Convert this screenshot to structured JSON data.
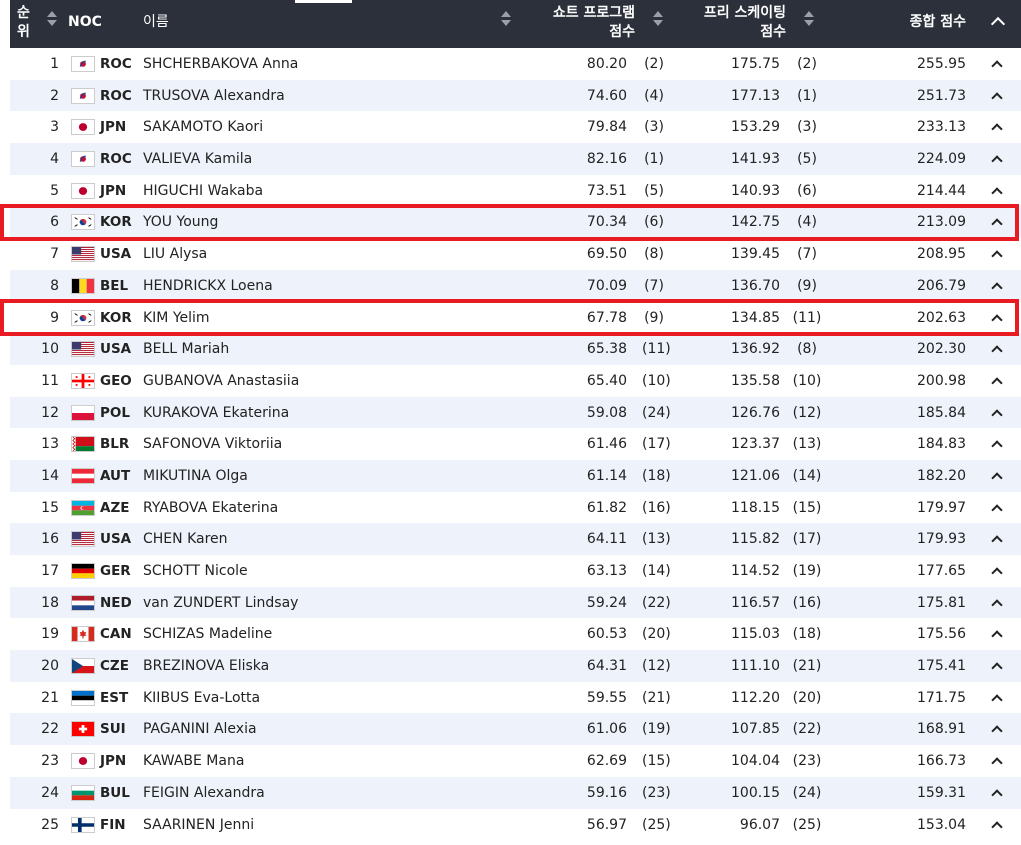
{
  "header": {
    "rank_line1": "순",
    "rank_line2": "위",
    "noc": "NOC",
    "name": "이름",
    "sp_line1": "쇼트 프로그램",
    "sp_line2": "점수",
    "fs_line1": "프리 스케이팅",
    "fs_line2": "점수",
    "total": "종합 점수"
  },
  "highlighted_ranks": [
    6,
    9
  ],
  "rows": [
    {
      "rank": "1",
      "flag": "ROC",
      "noc": "ROC",
      "name": "SHCHERBAKOVA Anna",
      "sp": "80.20",
      "sp_rank": "(2)",
      "fs": "175.75",
      "fs_rank": "(2)",
      "total": "255.95"
    },
    {
      "rank": "2",
      "flag": "ROC",
      "noc": "ROC",
      "name": "TRUSOVA Alexandra",
      "sp": "74.60",
      "sp_rank": "(4)",
      "fs": "177.13",
      "fs_rank": "(1)",
      "total": "251.73"
    },
    {
      "rank": "3",
      "flag": "JPN",
      "noc": "JPN",
      "name": "SAKAMOTO Kaori",
      "sp": "79.84",
      "sp_rank": "(3)",
      "fs": "153.29",
      "fs_rank": "(3)",
      "total": "233.13"
    },
    {
      "rank": "4",
      "flag": "ROC",
      "noc": "ROC",
      "name": "VALIEVA Kamila",
      "sp": "82.16",
      "sp_rank": "(1)",
      "fs": "141.93",
      "fs_rank": "(5)",
      "total": "224.09"
    },
    {
      "rank": "5",
      "flag": "JPN",
      "noc": "JPN",
      "name": "HIGUCHI Wakaba",
      "sp": "73.51",
      "sp_rank": "(5)",
      "fs": "140.93",
      "fs_rank": "(6)",
      "total": "214.44"
    },
    {
      "rank": "6",
      "flag": "KOR",
      "noc": "KOR",
      "name": "YOU Young",
      "sp": "70.34",
      "sp_rank": "(6)",
      "fs": "142.75",
      "fs_rank": "(4)",
      "total": "213.09"
    },
    {
      "rank": "7",
      "flag": "USA",
      "noc": "USA",
      "name": "LIU Alysa",
      "sp": "69.50",
      "sp_rank": "(8)",
      "fs": "139.45",
      "fs_rank": "(7)",
      "total": "208.95"
    },
    {
      "rank": "8",
      "flag": "BEL",
      "noc": "BEL",
      "name": "HENDRICKX Loena",
      "sp": "70.09",
      "sp_rank": "(7)",
      "fs": "136.70",
      "fs_rank": "(9)",
      "total": "206.79"
    },
    {
      "rank": "9",
      "flag": "KOR",
      "noc": "KOR",
      "name": "KIM Yelim",
      "sp": "67.78",
      "sp_rank": "(9)",
      "fs": "134.85",
      "fs_rank": "(11)",
      "total": "202.63"
    },
    {
      "rank": "10",
      "flag": "USA",
      "noc": "USA",
      "name": "BELL Mariah",
      "sp": "65.38",
      "sp_rank": "(11)",
      "fs": "136.92",
      "fs_rank": "(8)",
      "total": "202.30"
    },
    {
      "rank": "11",
      "flag": "GEO",
      "noc": "GEO",
      "name": "GUBANOVA Anastasiia",
      "sp": "65.40",
      "sp_rank": "(10)",
      "fs": "135.58",
      "fs_rank": "(10)",
      "total": "200.98"
    },
    {
      "rank": "12",
      "flag": "POL",
      "noc": "POL",
      "name": "KURAKOVA Ekaterina",
      "sp": "59.08",
      "sp_rank": "(24)",
      "fs": "126.76",
      "fs_rank": "(12)",
      "total": "185.84"
    },
    {
      "rank": "13",
      "flag": "BLR",
      "noc": "BLR",
      "name": "SAFONOVA Viktoriia",
      "sp": "61.46",
      "sp_rank": "(17)",
      "fs": "123.37",
      "fs_rank": "(13)",
      "total": "184.83"
    },
    {
      "rank": "14",
      "flag": "AUT",
      "noc": "AUT",
      "name": "MIKUTINA Olga",
      "sp": "61.14",
      "sp_rank": "(18)",
      "fs": "121.06",
      "fs_rank": "(14)",
      "total": "182.20"
    },
    {
      "rank": "15",
      "flag": "AZE",
      "noc": "AZE",
      "name": "RYABOVA Ekaterina",
      "sp": "61.82",
      "sp_rank": "(16)",
      "fs": "118.15",
      "fs_rank": "(15)",
      "total": "179.97"
    },
    {
      "rank": "16",
      "flag": "USA",
      "noc": "USA",
      "name": "CHEN Karen",
      "sp": "64.11",
      "sp_rank": "(13)",
      "fs": "115.82",
      "fs_rank": "(17)",
      "total": "179.93"
    },
    {
      "rank": "17",
      "flag": "GER",
      "noc": "GER",
      "name": "SCHOTT Nicole",
      "sp": "63.13",
      "sp_rank": "(14)",
      "fs": "114.52",
      "fs_rank": "(19)",
      "total": "177.65"
    },
    {
      "rank": "18",
      "flag": "NED",
      "noc": "NED",
      "name": "van ZUNDERT Lindsay",
      "sp": "59.24",
      "sp_rank": "(22)",
      "fs": "116.57",
      "fs_rank": "(16)",
      "total": "175.81"
    },
    {
      "rank": "19",
      "flag": "CAN",
      "noc": "CAN",
      "name": "SCHIZAS Madeline",
      "sp": "60.53",
      "sp_rank": "(20)",
      "fs": "115.03",
      "fs_rank": "(18)",
      "total": "175.56"
    },
    {
      "rank": "20",
      "flag": "CZE",
      "noc": "CZE",
      "name": "BREZINOVA Eliska",
      "sp": "64.31",
      "sp_rank": "(12)",
      "fs": "111.10",
      "fs_rank": "(21)",
      "total": "175.41"
    },
    {
      "rank": "21",
      "flag": "EST",
      "noc": "EST",
      "name": "KIIBUS Eva-Lotta",
      "sp": "59.55",
      "sp_rank": "(21)",
      "fs": "112.20",
      "fs_rank": "(20)",
      "total": "171.75"
    },
    {
      "rank": "22",
      "flag": "SUI",
      "noc": "SUI",
      "name": "PAGANINI Alexia",
      "sp": "61.06",
      "sp_rank": "(19)",
      "fs": "107.85",
      "fs_rank": "(22)",
      "total": "168.91"
    },
    {
      "rank": "23",
      "flag": "JPN",
      "noc": "JPN",
      "name": "KAWABE Mana",
      "sp": "62.69",
      "sp_rank": "(15)",
      "fs": "104.04",
      "fs_rank": "(23)",
      "total": "166.73"
    },
    {
      "rank": "24",
      "flag": "BUL",
      "noc": "BUL",
      "name": "FEIGIN Alexandra",
      "sp": "59.16",
      "sp_rank": "(23)",
      "fs": "100.15",
      "fs_rank": "(24)",
      "total": "159.31"
    },
    {
      "rank": "25",
      "flag": "FIN",
      "noc": "FIN",
      "name": "SAARINEN Jenni",
      "sp": "56.97",
      "sp_rank": "(25)",
      "fs": "96.07",
      "fs_rank": "(25)",
      "total": "153.04"
    }
  ],
  "colors": {
    "header_bg": "#2b303b",
    "row_alt_bg": "#eef3fb",
    "highlight_border": "#e81b23"
  }
}
